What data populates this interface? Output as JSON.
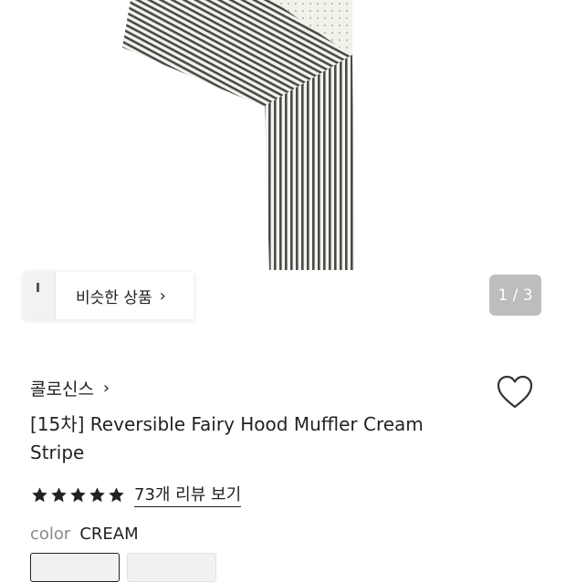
{
  "similar_products": {
    "label": "비슷한 상품"
  },
  "image_counter": {
    "text": "1 / 3",
    "current": 1,
    "total": 3
  },
  "brand": {
    "name": "콜로신스"
  },
  "product": {
    "title": "[15차] Reversible Fairy Hood Muffler Cream Stripe"
  },
  "rating": {
    "stars": 5,
    "review_link": "73개 리뷰 보기"
  },
  "color": {
    "label": "color",
    "value": "CREAM",
    "options": [
      "CREAM",
      ""
    ]
  },
  "icons": {
    "similar_chevron": "chevron-right-icon",
    "brand_chevron": "chevron-right-icon",
    "wishlist": "heart-icon",
    "star": "star-icon"
  },
  "colors": {
    "counter_bg": "#bdbdbd",
    "star": "#222222",
    "text": "#222222",
    "muted": "#8a8a8a"
  }
}
